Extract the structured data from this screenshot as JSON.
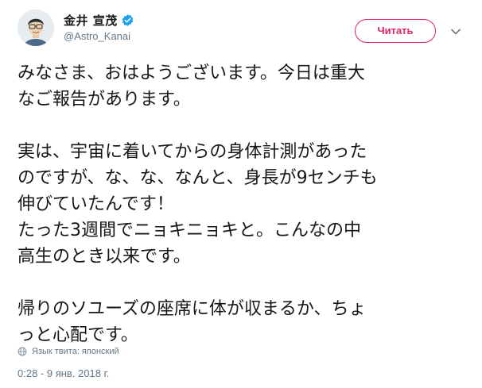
{
  "author": {
    "display_name": "金井 宣茂",
    "handle": "@Astro_Kanai",
    "verified": true
  },
  "actions": {
    "read_label": "Читать"
  },
  "tweet": {
    "lines": [
      "みなさま、おはようございます。今日は重大",
      "なご報告があります。",
      "",
      "実は、宇宙に着いてからの身体計測があった",
      "のですが、な、な、なんと、身長が9センチも",
      "伸びていたんです！",
      "たった3週間でニョキニョキと。こんなの中",
      "高生のとき以来です。",
      "",
      "帰りのソユーズの座席に体が収まるか、ちょ",
      "っと心配です。"
    ],
    "language_note": "Язык твита: японский",
    "timestamp": "0:28 - 9 янв. 2018 г."
  },
  "colors": {
    "accent": "#e0245e",
    "verified": "#1da1f2",
    "secondary_text": "#657786",
    "primary_text": "#14171a"
  },
  "icons": [
    "verified-badge-icon",
    "chevron-down-icon",
    "globe-icon"
  ]
}
